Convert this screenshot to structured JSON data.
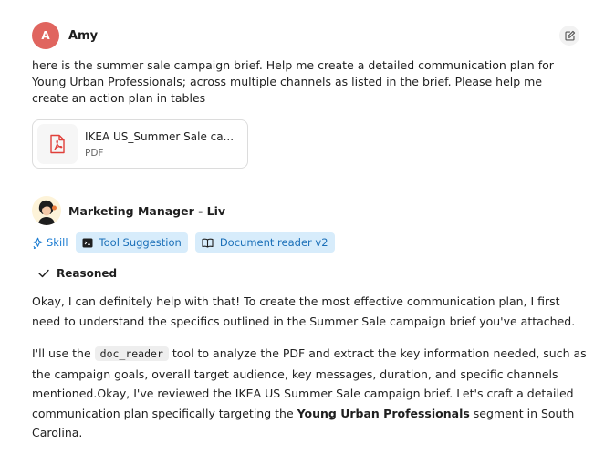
{
  "user": {
    "initial": "A",
    "name": "Amy",
    "avatar_color": "#e0655f",
    "message": "here is the summer sale campaign brief. Help me create a detailed communication plan for Young Urban Professionals; across multiple channels as listed in the brief. Please help me create an action plan in tables"
  },
  "attachment": {
    "name": "IKEA US_Summer Sale ca...",
    "type": "PDF",
    "icon": "pdf-file-icon",
    "icon_color": "#e0403a"
  },
  "agent": {
    "name": "Marketing Manager - Liv",
    "skill_label": "Skill",
    "tags": [
      "Tool Suggestion",
      "Document reader v2"
    ],
    "tag_bg": "#d7ecfb",
    "accent": "#1a7bd1",
    "reasoned_label": "Reasoned"
  },
  "response": {
    "p1": "Okay, I can definitely help with that! To create the most effective communication plan, I first need to understand the specifics outlined in the Summer Sale campaign brief you've attached.",
    "p2_pre": "I'll use the",
    "p2_code": "doc_reader",
    "p2_mid": "tool to analyze the PDF and extract the key information needed, such as the campaign goals, overall target audience, key messages, duration, and specific channels mentioned.Okay, I've reviewed the IKEA US Summer Sale campaign brief. Let's craft a detailed communication plan specifically targeting the",
    "p2_bold": "Young Urban Professionals",
    "p2_post": "segment in South Carolina."
  }
}
